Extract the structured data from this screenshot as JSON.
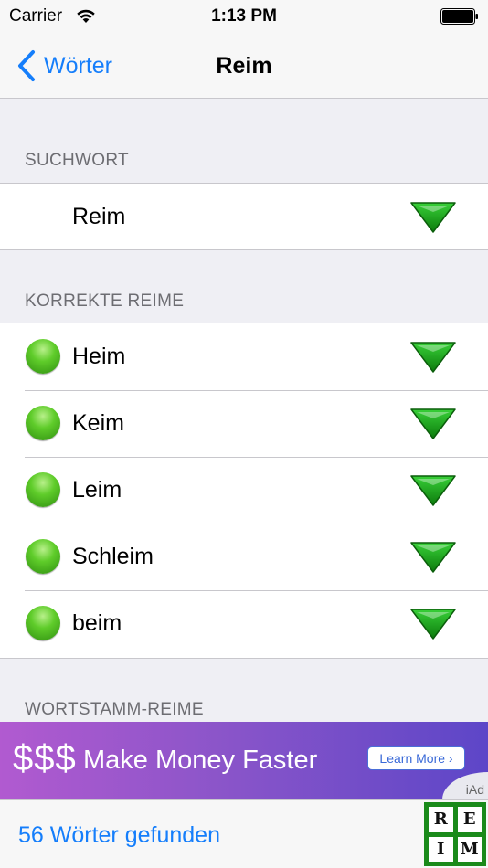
{
  "status_bar": {
    "carrier": "Carrier",
    "time": "1:13 PM"
  },
  "nav": {
    "back_label": "Wörter",
    "title": "Reim"
  },
  "sections": {
    "suchwort": {
      "header": "SUCHWORT",
      "word": "Reim"
    },
    "korrekte": {
      "header": "KORREKTE REIME",
      "items": [
        "Heim",
        "Keim",
        "Leim",
        "Schleim",
        "beim"
      ]
    },
    "wortstamm": {
      "header": "WORTSTAMM-REIME"
    }
  },
  "ad": {
    "dollars": "$$$",
    "text": "Make Money Faster",
    "button": "Learn More ›",
    "badge": "iAd"
  },
  "footer": {
    "count_text": "56 Wörter gefunden",
    "logo_letters": [
      "R",
      "E",
      "I",
      "M"
    ]
  },
  "colors": {
    "accent": "#157efb",
    "dot_green": "#5fcc2a",
    "chevron_green": "#1e9e1e",
    "logo_green": "#1a8a1a"
  },
  "icons": {
    "back": "chevron-left-icon",
    "expand": "triangle-down-icon",
    "status": "green-dot-icon"
  }
}
